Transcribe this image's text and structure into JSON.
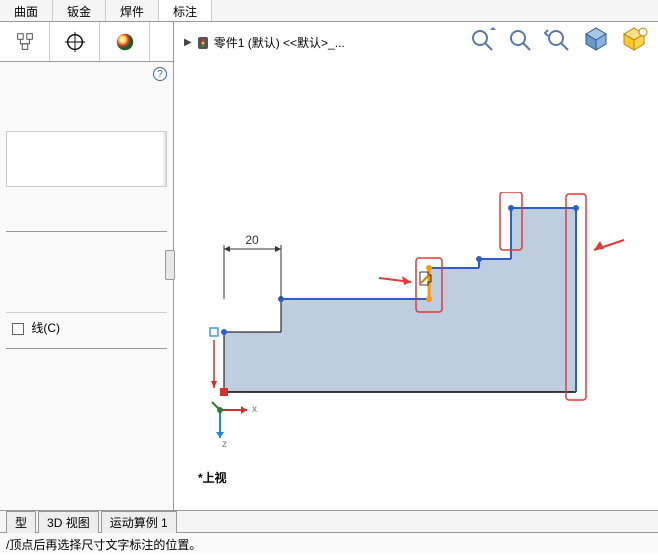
{
  "ribbon": {
    "tabs": [
      "曲面",
      "钣金",
      "焊件",
      "标注"
    ],
    "active": 3
  },
  "breadcrumb": {
    "part_label": "零件1 (默认) <<默认>_..."
  },
  "left_panel": {
    "help_icon_title": "?",
    "centerline_label": "线(C)"
  },
  "sketch": {
    "dimension_value": "20",
    "view_name": "*上视"
  },
  "triad": {
    "x": "x",
    "z": "z"
  },
  "bottom_tabs": {
    "items": [
      "型",
      "3D 视图",
      "运动算例 1"
    ]
  },
  "status_bar": {
    "hint": "/顶点后再选择尺寸文字标注的位置。"
  },
  "icons": {
    "tree": "tree-icon",
    "target": "target-icon",
    "appearance": "appearance-icon"
  }
}
